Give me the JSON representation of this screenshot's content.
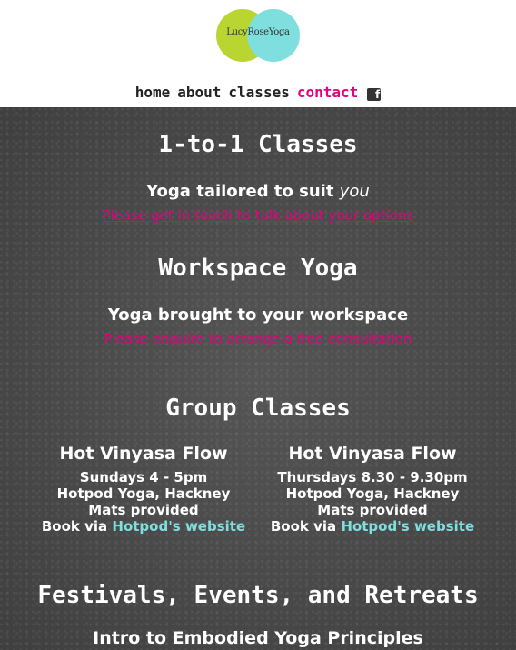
{
  "logo": {
    "text": "LucyRoseYoga"
  },
  "nav": {
    "items": [
      {
        "label": "home",
        "active": false
      },
      {
        "label": "about",
        "active": false
      },
      {
        "label": "classes",
        "active": false
      },
      {
        "label": "contact",
        "active": true
      }
    ],
    "facebook_icon": "facebook-icon",
    "facebook_glyph": "f"
  },
  "sections": {
    "one_to_one": {
      "heading": "1-to-1 Classes",
      "tagline": "Yoga tailored to suit",
      "tagline_em": "you",
      "link": "Please get in touch to talk about your options"
    },
    "workspace": {
      "heading": "Workspace Yoga",
      "tagline": "Yoga brought to your workspace",
      "link": "Please enquire to arrange a free consultation"
    },
    "group": {
      "heading": "Group Classes",
      "classes": [
        {
          "title": "Hot Vinyasa Flow",
          "time": "Sundays 4 - 5pm",
          "venue": "Hotpod Yoga, Hackney",
          "mats": "Mats provided",
          "book_prefix": "Book via",
          "book_link": "Hotpod's website"
        },
        {
          "title": "Hot Vinyasa Flow",
          "time": "Thursdays 8.30 - 9.30pm",
          "venue": "Hotpod Yoga, Hackney",
          "mats": "Mats provided",
          "book_prefix": "Book via",
          "book_link": "Hotpod's website"
        }
      ]
    },
    "festivals": {
      "heading": "Festivals, Events, and Retreats",
      "item": "Intro to Embodied Yoga Principles"
    }
  },
  "colors": {
    "accent": "#e6007e",
    "link_teal": "#7fdede",
    "logo_green": "#b9d532",
    "board": "#4a4a4a"
  }
}
